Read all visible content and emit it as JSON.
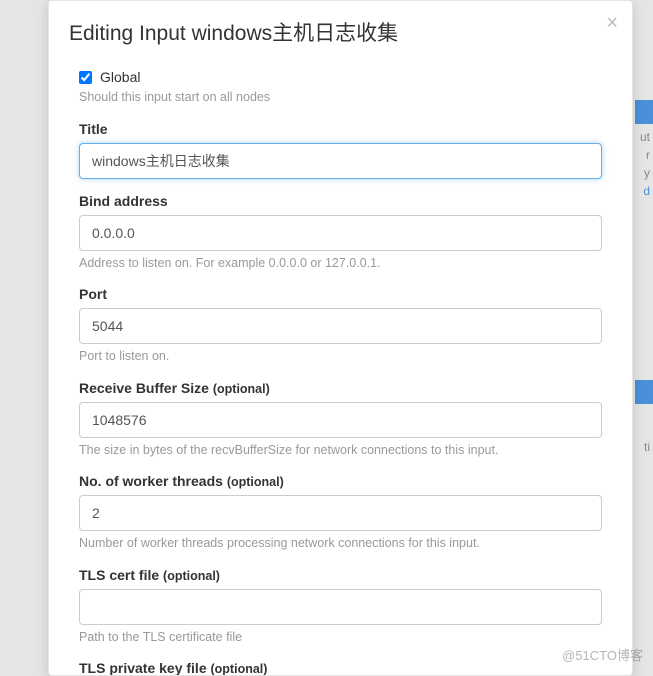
{
  "modal": {
    "title": "Editing Input windows主机日志收集",
    "close_label": "×"
  },
  "form": {
    "global": {
      "label": "Global",
      "checked": true,
      "help": "Should this input start on all nodes"
    },
    "title": {
      "label": "Title",
      "value": "windows主机日志收集"
    },
    "bind_address": {
      "label": "Bind address",
      "value": "0.0.0.0",
      "help": "Address to listen on. For example 0.0.0.0 or 127.0.0.1."
    },
    "port": {
      "label": "Port",
      "value": "5044",
      "help": "Port to listen on."
    },
    "receive_buffer": {
      "label": "Receive Buffer Size",
      "optional": "(optional)",
      "value": "1048576",
      "help": "The size in bytes of the recvBufferSize for network connections to this input."
    },
    "worker_threads": {
      "label": "No. of worker threads",
      "optional": "(optional)",
      "value": "2",
      "help": "Number of worker threads processing network connections for this input."
    },
    "tls_cert": {
      "label": "TLS cert file",
      "optional": "(optional)",
      "value": "",
      "help": "Path to the TLS certificate file"
    },
    "tls_key": {
      "label": "TLS private key file",
      "optional": "(optional)"
    }
  },
  "background": {
    "text_right_1": "ut",
    "text_right_2": "r",
    "text_right_3": "y",
    "text_right_4": "d",
    "text_right_5": "ti",
    "watermark": "@51CTO博客"
  }
}
